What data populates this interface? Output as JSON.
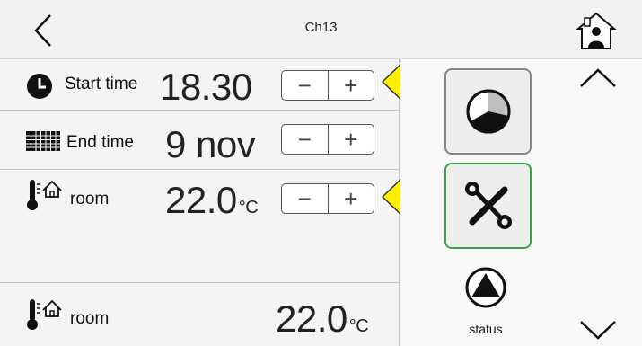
{
  "header": {
    "title": "Ch13"
  },
  "rows": {
    "start": {
      "label": "Start time",
      "value": "18.30",
      "minus": "−",
      "plus": "+"
    },
    "end": {
      "label": "End time",
      "value": "9 nov",
      "minus": "−",
      "plus": "+"
    },
    "room_set": {
      "label": "room",
      "value": "22.0",
      "unit": "°C",
      "minus": "−",
      "plus": "+"
    },
    "room_actual": {
      "label": "room",
      "value": "22.0",
      "unit": "°C"
    }
  },
  "side": {
    "status_label": "status"
  },
  "colors": {
    "arrow_fill": "#ffee00",
    "arrow_stroke": "#333333",
    "settings_border": "#3aa24a",
    "schedule_border": "#888888"
  },
  "icons": [
    "back-chevron-icon",
    "home-person-icon",
    "clock-icon",
    "calendar-grid-icon",
    "thermometer-house-icon",
    "pie-timer-icon",
    "tools-icon",
    "triangle-circle-icon",
    "chevron-up-icon",
    "chevron-down-icon"
  ]
}
